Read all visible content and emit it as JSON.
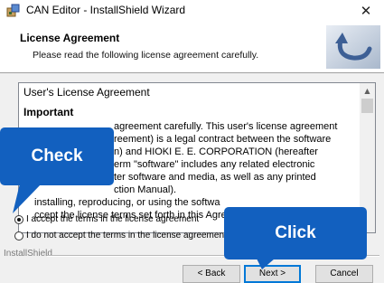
{
  "window": {
    "title": "CAN Editor - InstallShield Wizard",
    "close_glyph": "✕"
  },
  "header": {
    "title": "License Agreement",
    "subtitle": "Please read the following license agreement carefully."
  },
  "license": {
    "title": "User's License Agreement",
    "heading": "Important",
    "lines": [
      "agreement carefully. This user's license agreement",
      "reement) is a legal contract between the software",
      "n) and HIOKI E. E. CORPORATION (hereafter",
      "erm \"software\" includes any related electronic",
      "ter software and media, as well as any printed",
      "ction Manual).",
      "installing, reproducing, or using the softwa",
      "ccept the license terms set forth in this Agre"
    ]
  },
  "options": {
    "accept_label": "I accept the terms in the license agreement",
    "decline_label": "I do not accept the terms in the license agreement",
    "selected": "accept"
  },
  "footer": {
    "brand": "InstallShield"
  },
  "buttons": {
    "back": "< Back",
    "next": "Next >",
    "cancel": "Cancel"
  },
  "annotations": {
    "check": "Check",
    "click": "Click",
    "color": "#1260bf"
  },
  "icons": {
    "app": "installer-icon",
    "logo": "installshield-arrow-logo",
    "close": "close-icon"
  }
}
